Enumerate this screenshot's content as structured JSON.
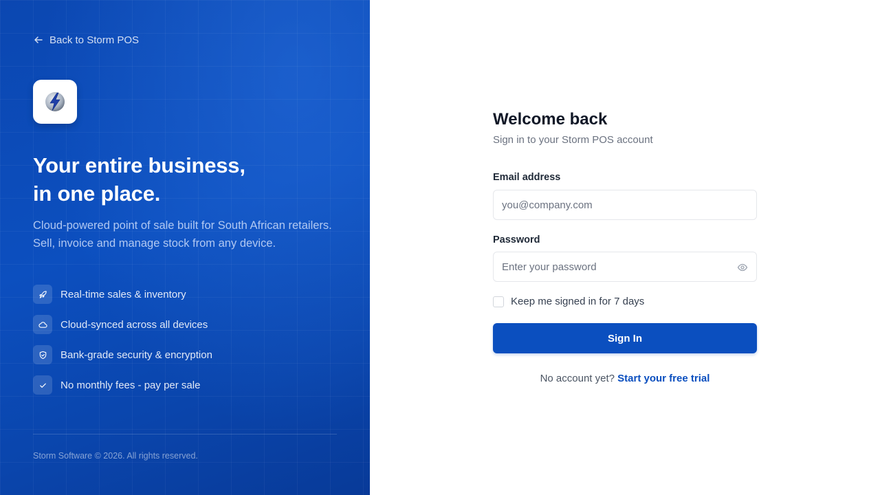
{
  "brand": {
    "back_link": "Back to Storm POS",
    "headline_line1": "Your entire business,",
    "headline_line2": "in one place.",
    "description": "Cloud-powered point of sale built for South African retailers. Sell, invoice and manage stock from any device.",
    "features": [
      {
        "icon": "rocket-icon",
        "label": "Real-time sales & inventory"
      },
      {
        "icon": "cloud-icon",
        "label": "Cloud-synced across all devices"
      },
      {
        "icon": "shield-check-icon",
        "label": "Bank-grade security & encryption"
      },
      {
        "icon": "check-icon",
        "label": "No monthly fees - pay per sale"
      }
    ],
    "copyright": "Storm Software © 2026. All rights reserved."
  },
  "form": {
    "title": "Welcome back",
    "subtitle": "Sign in to your Storm POS account",
    "email_label": "Email address",
    "email_placeholder": "you@company.com",
    "email_value": "",
    "password_label": "Password",
    "password_placeholder": "Enter your password",
    "password_value": "",
    "remember_label": "Keep me signed in for 7 days",
    "remember_checked": false,
    "submit_label": "Sign In",
    "no_account_text": "No account yet?",
    "trial_link": "Start your free trial"
  },
  "colors": {
    "panel_blue": "#0c4fbf",
    "primary_button": "#0b4fbf",
    "link": "#0b4fbf",
    "heading": "#111827",
    "muted": "#6b7280"
  }
}
